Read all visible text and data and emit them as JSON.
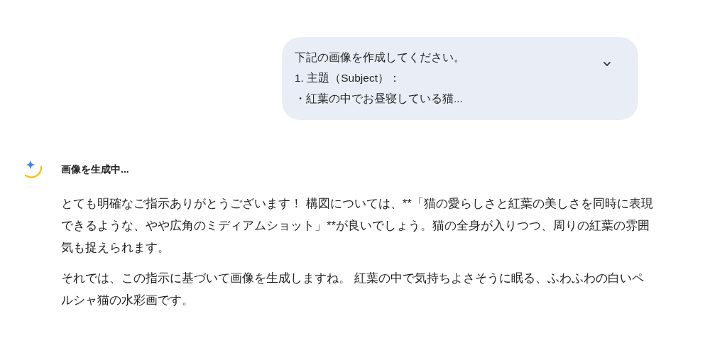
{
  "user_message": {
    "lines": [
      "下記の画像を作成してください。",
      "1. 主題（Subject）：",
      "・紅葉の中でお昼寝している猫..."
    ],
    "expanded": false
  },
  "response": {
    "status": "画像を生成中...",
    "paragraphs": [
      "とても明確なご指示ありがとうございます！ 構図については、**「猫の愛らしさと紅葉の美しさを同時に表現できるような、やや広角のミディアムショット」**が良いでしょう。猫の全身が入りつつ、周りの紅葉の雰囲気も捉えられます。",
      "それでは、この指示に基づいて画像を生成しますね。 紅葉の中で気持ちよさそうに眠る、ふわふわの白いペルシャ猫の水彩画です。"
    ]
  }
}
